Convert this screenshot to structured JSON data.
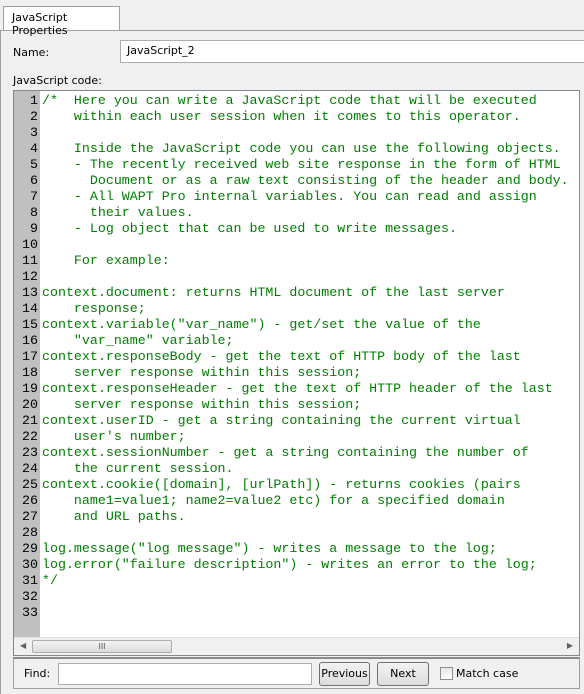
{
  "tab": {
    "label": "JavaScript Properties"
  },
  "name": {
    "label": "Name:",
    "value": "JavaScript_2"
  },
  "code_label": "JavaScript code:",
  "code_lines": [
    "/*  Here you can write a JavaScript code that will be executed",
    "    within each user session when it comes to this operator.",
    "",
    "    Inside the JavaScript code you can use the following objects.",
    "    - The recently received web site response in the form of HTML",
    "      Document or as a raw text consisting of the header and body.",
    "    - All WAPT Pro internal variables. You can read and assign",
    "      their values.",
    "    - Log object that can be used to write messages.",
    "",
    "    For example:",
    "",
    "context.document: returns HTML document of the last server",
    "    response;",
    "context.variable(\"var_name\") - get/set the value of the",
    "    \"var_name\" variable;",
    "context.responseBody - get the text of HTTP body of the last",
    "    server response within this session;",
    "context.responseHeader - get the text of HTTP header of the last",
    "    server response within this session;",
    "context.userID - get a string containing the current virtual",
    "    user's number;",
    "context.sessionNumber - get a string containing the number of",
    "    the current session.",
    "context.cookie([domain], [urlPath]) - returns cookies (pairs",
    "    name1=value1; name2=value2 etc) for a specified domain",
    "    and URL paths.",
    "",
    "log.message(\"log message\") - writes a message to the log;",
    "log.error(\"failure description\") - writes an error to the log;",
    "*/",
    "",
    ""
  ],
  "colors": {
    "comment": "#008000",
    "gutter": "#c0c0c0"
  },
  "find": {
    "label": "Find:",
    "value": "",
    "previous": "Previous",
    "next": "Next",
    "match_case": "Match case",
    "match_case_checked": false
  },
  "scrollbar": {
    "grip": "III"
  }
}
